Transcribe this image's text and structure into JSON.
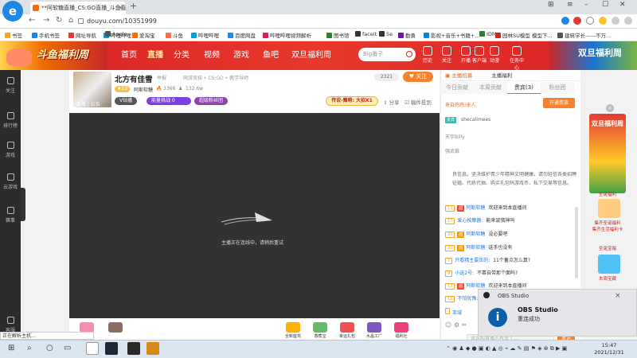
{
  "browser": {
    "tab_title": "**阿软糖直播_CS:GO直播_斗鱼直",
    "url": "douyu.com/10351999",
    "status_text": "正在解析主机..."
  },
  "bookmarks": [
    "书签",
    "手机书签",
    "网址导航",
    "哔哩哔哩",
    "Apple",
    "爱淘宝",
    "斗鱼",
    "哔哩哔哩",
    "百度网盘",
    "哔哩哔哩视频解析",
    "图书馆",
    "faceit",
    "5e",
    "勤勇",
    "影视+音乐+书籍+...",
    "IDM",
    "园林SU模型 模型下...",
    "建筑学长——不万..."
  ],
  "header": {
    "banner_left": "斗鱼福利周",
    "menu": [
      "首页",
      "直播",
      "分类",
      "视频",
      "游戏",
      "鱼吧",
      "双旦福利周"
    ],
    "search_placeholder": "Big番子",
    "icons": [
      "历史",
      "关注",
      "开播",
      "客户端",
      "动漫",
      "任务中心"
    ],
    "banner_right": "双旦福利周"
  },
  "sidebar": [
    "关注",
    "排行榜",
    "游戏",
    "云游戏",
    "赛事",
    "客服"
  ],
  "room": {
    "title": "北方有佳雪",
    "report": "举报",
    "categories": "网游竞技 • CS:GO • 教学导师",
    "level": "13",
    "anchor": "阿斯软糖",
    "hot": "3366",
    "followers": "132.6w",
    "avatar_label": "直播",
    "avatar_notice": "公告",
    "badges": [
      "V钻播",
      "能量挑战 0",
      "超级粉丝团"
    ],
    "count": "2321",
    "follow_btn": "关注",
    "combo": "传说·魔萌: 大招X1",
    "share": "分享",
    "fav": "稿件投到"
  },
  "video": {
    "message": "主播正在连线中，请稍后重试"
  },
  "gifts": [
    "全新座驾",
    "香蕉宝",
    "幸运礼包",
    "水晶工厂",
    "福利社"
  ],
  "chat": {
    "top": [
      "主播招募",
      "主播福利"
    ],
    "tabs": [
      "今日贡献",
      "本周贡献",
      "贵宾(3)",
      "粉丝团"
    ],
    "vip_text": "来自鸡鸡!来人",
    "vip_label": "贵宾",
    "open_btn": "开通贵族",
    "users": [
      "shecalimees",
      "天宇Billy",
      "强武裁"
    ],
    "notice": "良信息。坚决维护青少年精神文明健康。请勿轻信各类招聘征婚、代练代抽、购买礼包码游戏币、私下交易等信息。",
    "messages": [
      {
        "level": "13",
        "user": "阿斯软糖",
        "text": "欢迎来到本直播间"
      },
      {
        "level": "17",
        "user": "爱心按摩器:",
        "text": "能来波猎神吗"
      },
      {
        "level": "20",
        "user": "阿斯软糖",
        "text": "没必要吧"
      },
      {
        "level": "20",
        "user": "阿斯软糖",
        "text": "选手也没有"
      },
      {
        "level": "7",
        "user": "只看精主要压的:",
        "text": "11个蓄点怎么算?"
      },
      {
        "level": "9",
        "user": "小选2号:",
        "text": "不靠自带那个面吗?"
      },
      {
        "level": "13",
        "user": "阿斯软糖",
        "text": "欢迎来到本直播间"
      },
      {
        "level": "11",
        "user": "不怕犹豫:",
        "text": "..."
      },
      {
        "level": "",
        "user": "亚域",
        "text": ""
      }
    ],
    "input_placeholder": "说说和直播人有没了...",
    "send": "发送"
  },
  "ads": {
    "main": "双旦福利周",
    "items": [
      "圣诞福利",
      "集卡活动",
      "集齐圣诞福利",
      "集齐生活福利卡",
      "圣诞宝箱",
      "本周宝藏"
    ]
  },
  "obs": {
    "header": "OBS Studio",
    "title": "OBS Studio",
    "subtitle": "重连成功"
  },
  "taskbar": {
    "time": "15:47",
    "date": "2021/12/31"
  }
}
